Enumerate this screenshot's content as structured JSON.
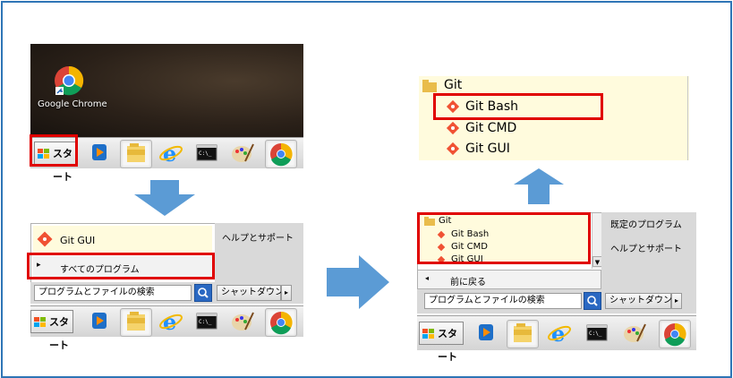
{
  "colors": {
    "accent_arrow": "#5b9bd5",
    "highlight_box": "#e00000",
    "frame": "#2e75b6"
  },
  "desktop": {
    "chrome_label": "Google Chrome"
  },
  "taskbar": {
    "start_label": "スタート",
    "icons": [
      "media-player-icon",
      "file-explorer-icon",
      "internet-explorer-icon",
      "command-prompt-icon",
      "paint-icon",
      "chrome-icon"
    ]
  },
  "menu1": {
    "pinned_item": "Git GUI",
    "all_programs": "すべてのプログラム",
    "help": "ヘルプとサポート",
    "search_placeholder": "プログラムとファイルの検索",
    "shutdown": "シャットダウン"
  },
  "menu2": {
    "folder": "Git",
    "items": [
      "Git Bash",
      "Git CMD",
      "Git GUI"
    ],
    "back": "前に戻る",
    "default_programs": "既定のプログラム",
    "help": "ヘルプとサポート",
    "search_placeholder": "プログラムとファイルの検索",
    "shutdown": "シャットダウン"
  },
  "zoom": {
    "folder": "Git",
    "items": [
      "Git Bash",
      "Git CMD",
      "Git GUI"
    ]
  }
}
